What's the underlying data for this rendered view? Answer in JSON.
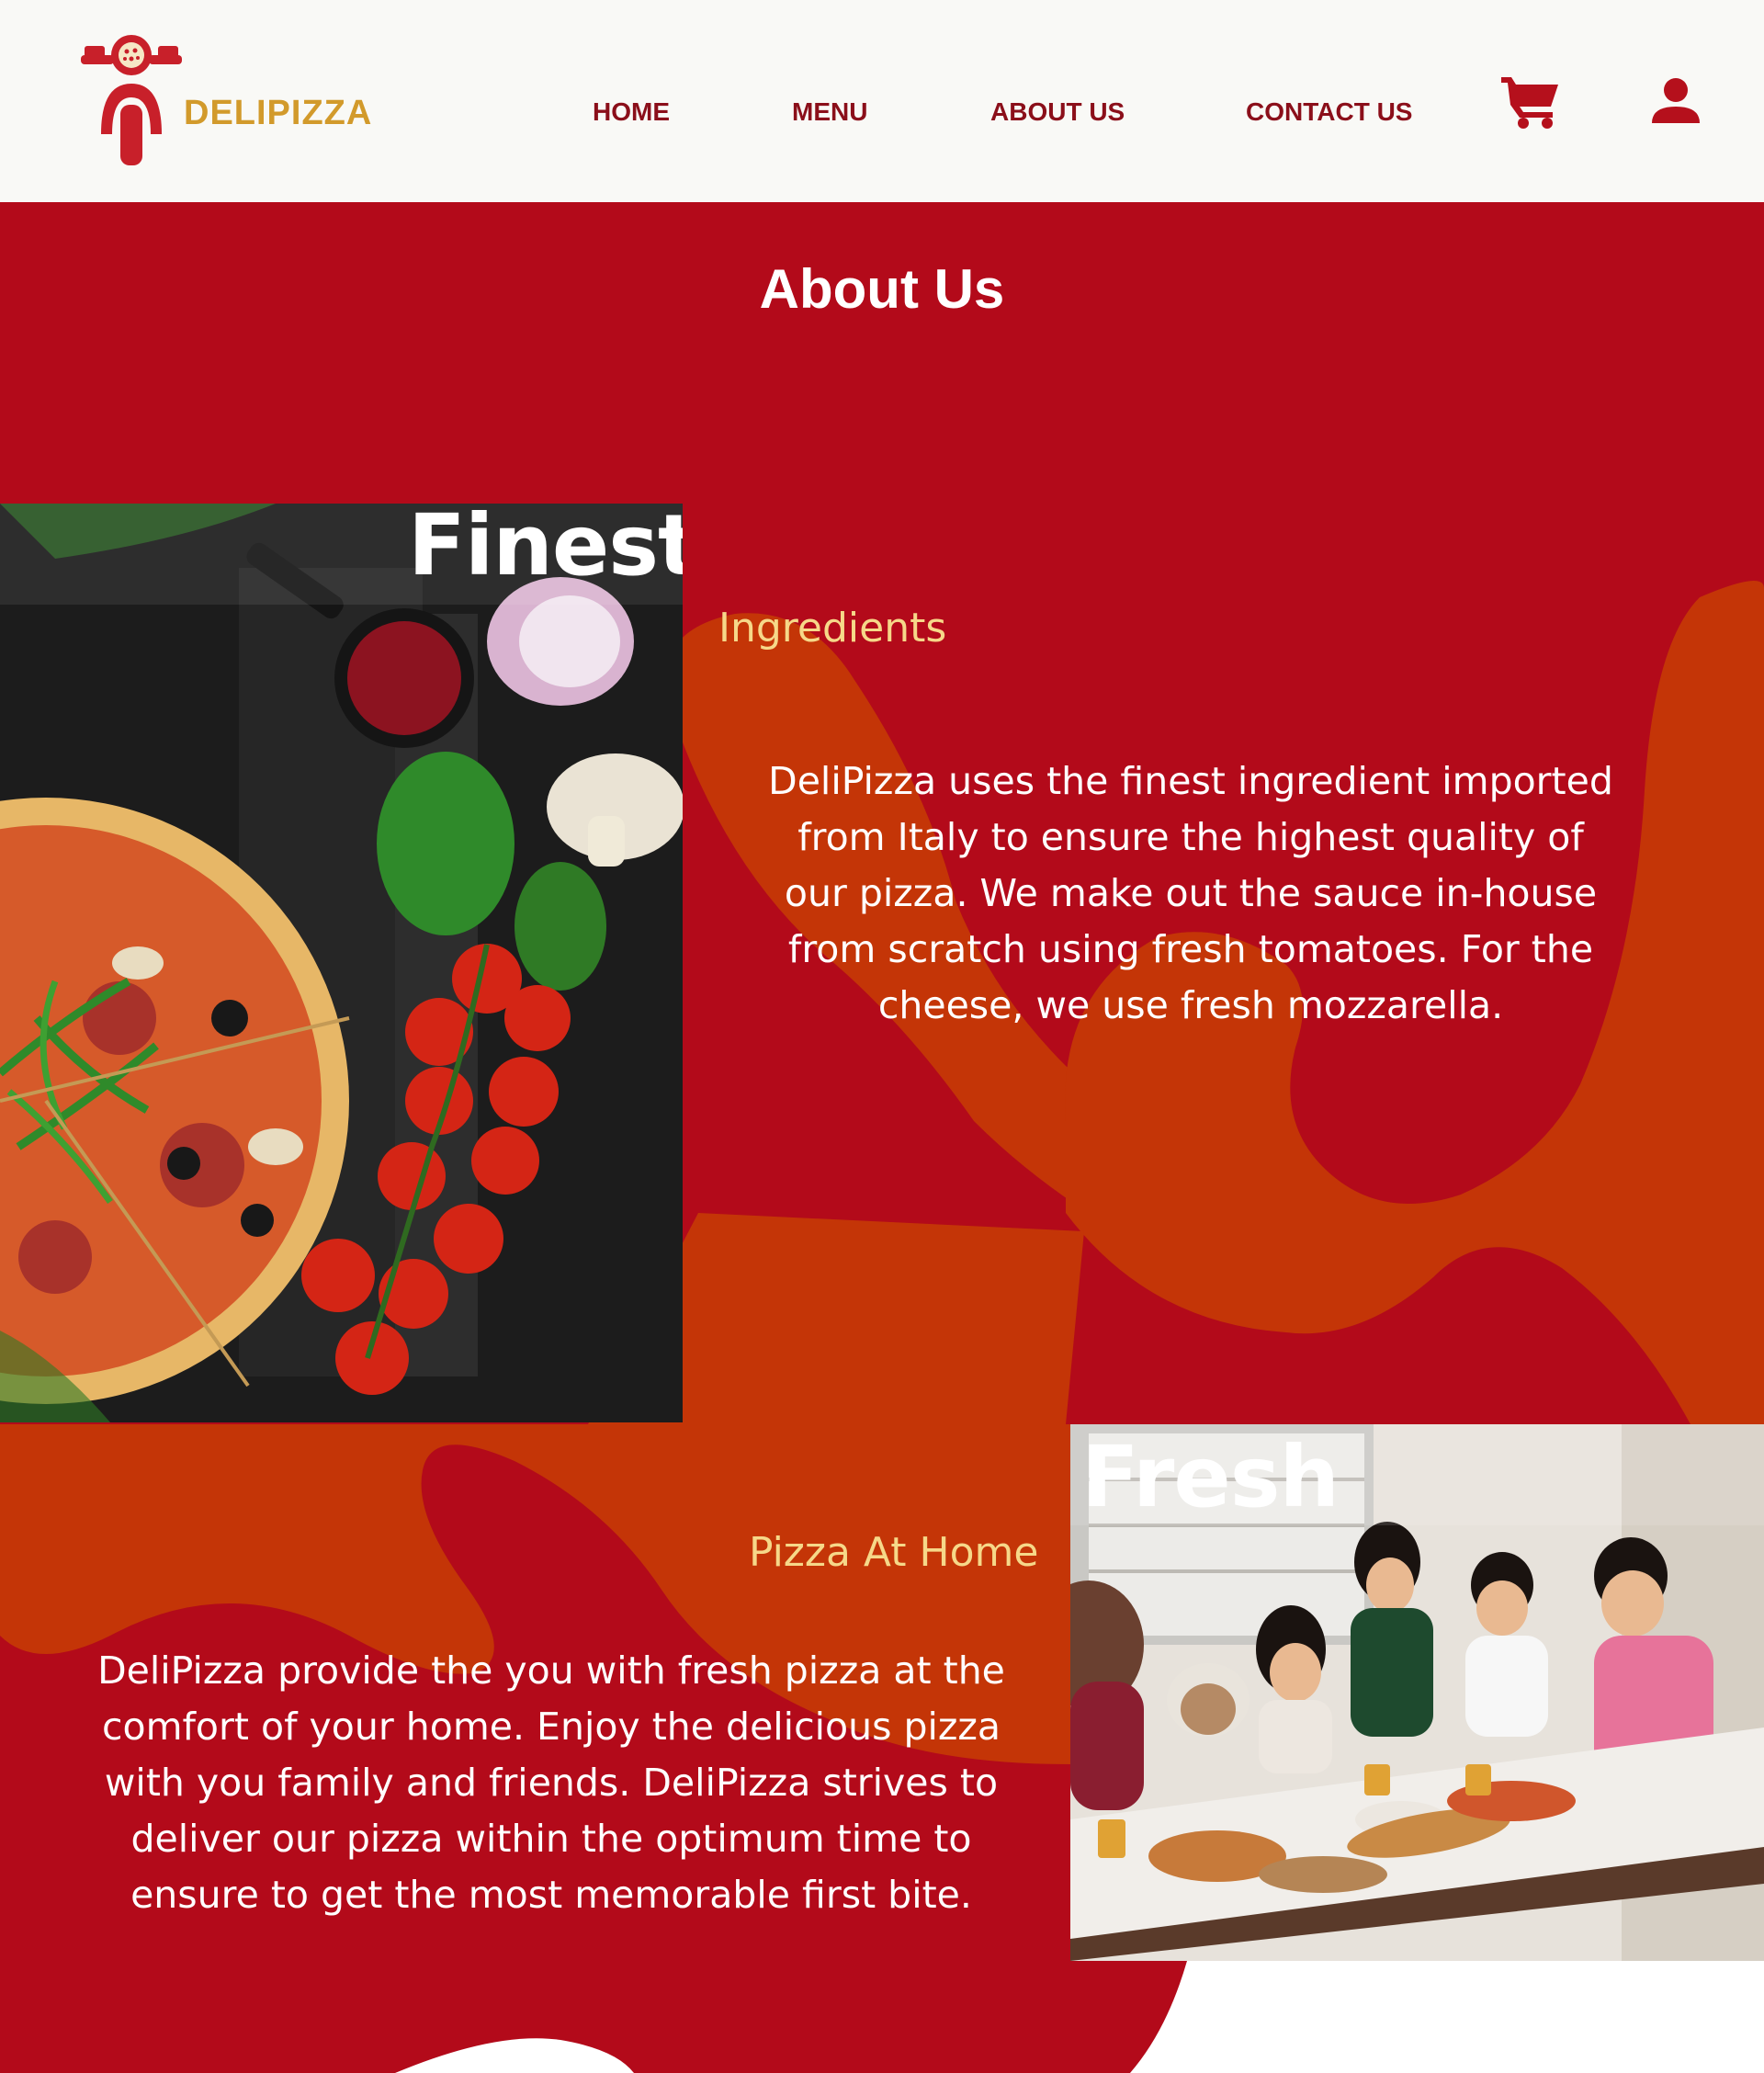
{
  "brand": {
    "name": "DELIPIZZA"
  },
  "nav": {
    "items": [
      {
        "label": "HOME"
      },
      {
        "label": "MENU"
      },
      {
        "label": "ABOUT US"
      },
      {
        "label": "CONTACT US"
      }
    ],
    "cart_icon": "cart-icon",
    "account_icon": "user-icon"
  },
  "page": {
    "title": "About Us"
  },
  "section_finest": {
    "image_word": "Finest",
    "subheading": "Ingredients",
    "paragraph": "DeliPizza uses the finest ingredient imported from Italy to ensure the highest quality of our pizza. We make out the sauce in-house from scratch using fresh tomatoes. For the cheese, we use fresh mozzarella."
  },
  "section_fresh": {
    "image_word": "Fresh",
    "subheading": "Pizza At Home",
    "paragraph": "DeliPizza provide the you with fresh pizza at the comfort of your home. Enjoy the delicious pizza with you family and friends. DeliPizza strives to deliver our pizza within the optimum time to ensure to get the most memorable first bite."
  },
  "colors": {
    "primary_red": "#b30a1a",
    "blob_orange": "#c43507",
    "accent_gold": "#d29a2b",
    "subheading_gold": "#f6d889",
    "nav_red": "#8b0f1a",
    "header_bg": "#f9f9f6"
  }
}
